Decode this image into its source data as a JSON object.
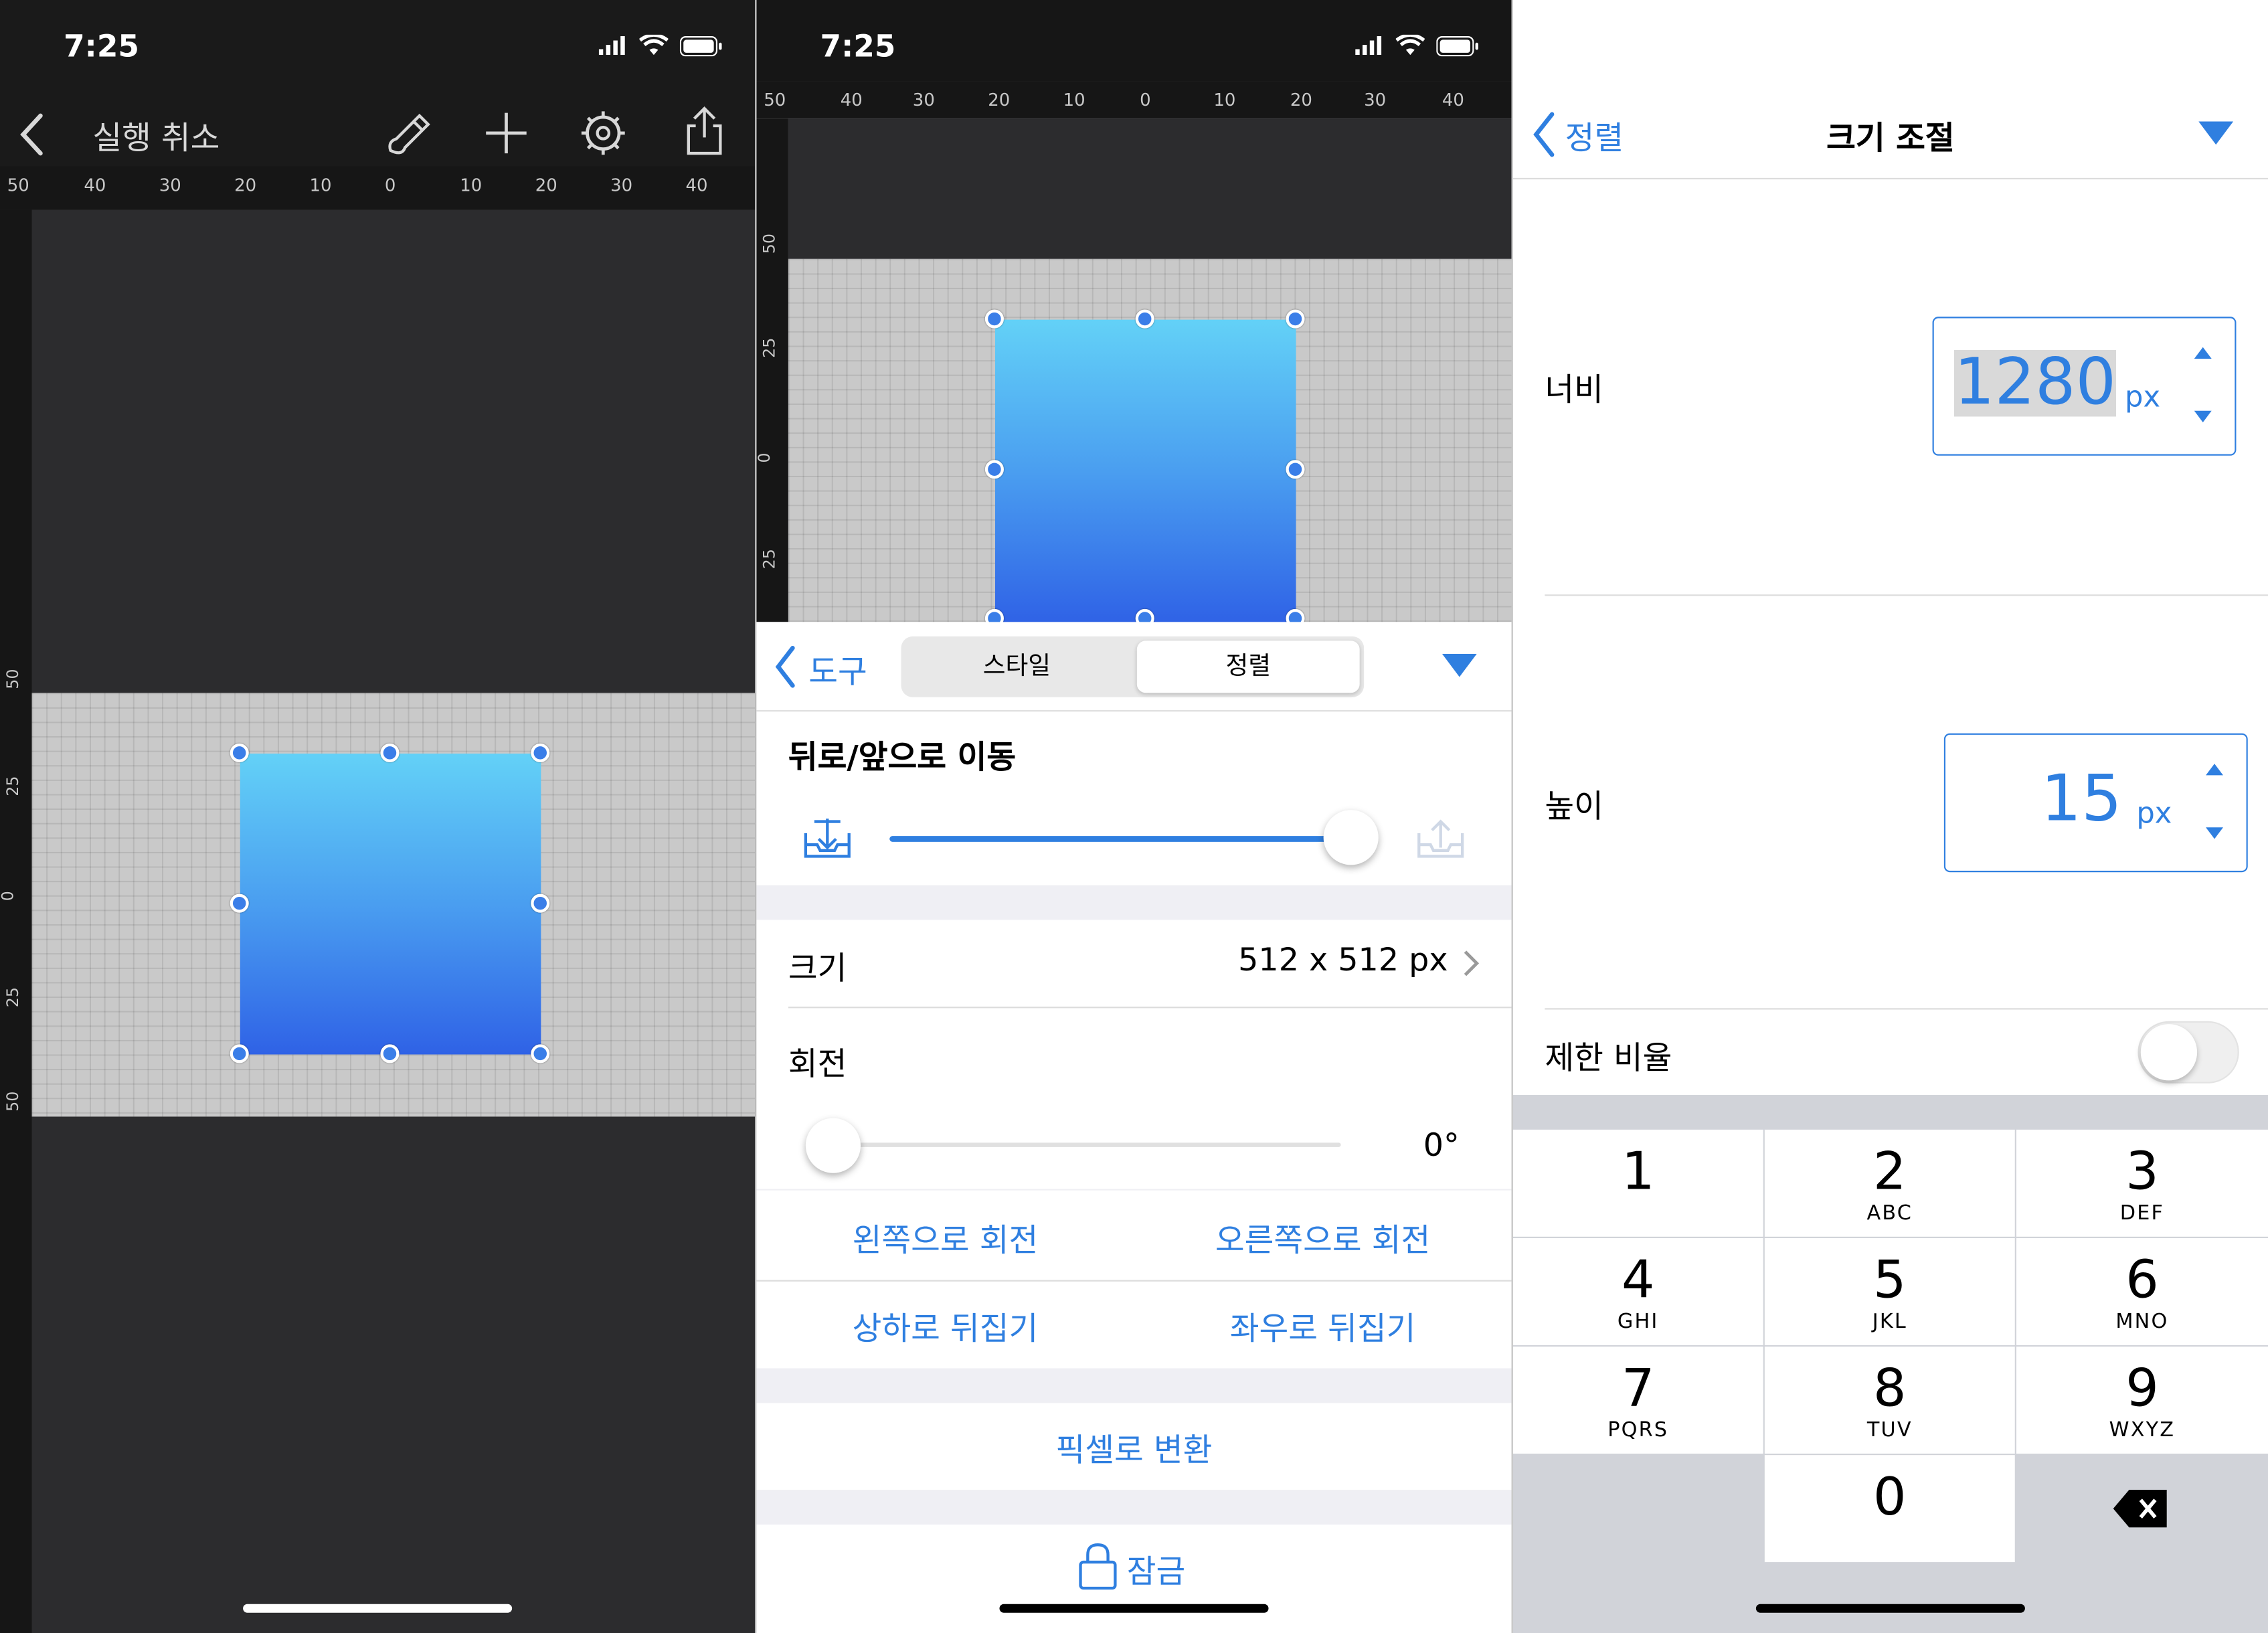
{
  "status": {
    "time": "7:25"
  },
  "ruler": {
    "h_ticks": [
      "50",
      "40",
      "30",
      "20",
      "10",
      "0",
      "10",
      "20",
      "30",
      "40"
    ],
    "v_ticks": [
      "50",
      "25",
      "0",
      "25",
      "50"
    ]
  },
  "panel1": {
    "undo_label": "실행 취소",
    "icons": [
      "back-chevron-icon",
      "paintbrush-icon",
      "plus-icon",
      "gear-icon",
      "share-icon"
    ]
  },
  "panel2": {
    "back_label": "도구",
    "tabs": [
      "스타일",
      "정렬"
    ],
    "selected_tab": "정렬",
    "arrange": {
      "title": "뒤로/앞으로 이동",
      "slider_value": 1.0
    },
    "size": {
      "label": "크기",
      "value": "512 x 512 px"
    },
    "rotation": {
      "label": "회전",
      "value": "0°",
      "slider_value": 0.0
    },
    "actions": {
      "rotate_left": "왼쪽으로 회전",
      "rotate_right": "오른쪽으로 회전",
      "flip_vertical": "상하로 뒤집기",
      "flip_horizontal": "좌우로 뒤집기"
    },
    "convert": "픽셀로 변환",
    "lock": "잠금"
  },
  "panel3": {
    "back_label": "정렬",
    "title": "크기 조절",
    "width": {
      "label": "너비",
      "value": "1280",
      "unit": "px"
    },
    "height": {
      "label": "높이",
      "value": "15",
      "unit": "px"
    },
    "constrain": {
      "label": "제한 비율",
      "on": false
    },
    "keypad": [
      {
        "num": "1",
        "letters": ""
      },
      {
        "num": "2",
        "letters": "ABC"
      },
      {
        "num": "3",
        "letters": "DEF"
      },
      {
        "num": "4",
        "letters": "GHI"
      },
      {
        "num": "5",
        "letters": "JKL"
      },
      {
        "num": "6",
        "letters": "MNO"
      },
      {
        "num": "7",
        "letters": "PQRS"
      },
      {
        "num": "8",
        "letters": "TUV"
      },
      {
        "num": "9",
        "letters": "WXYZ"
      },
      {
        "num": "0",
        "letters": ""
      }
    ]
  },
  "colors": {
    "accent": "#2f7fe0",
    "dark_bg": "#2c2c2e",
    "canvas_grid": "#c9c9c9",
    "shape_top": "#63d1f7",
    "shape_bottom": "#2f62e6"
  }
}
